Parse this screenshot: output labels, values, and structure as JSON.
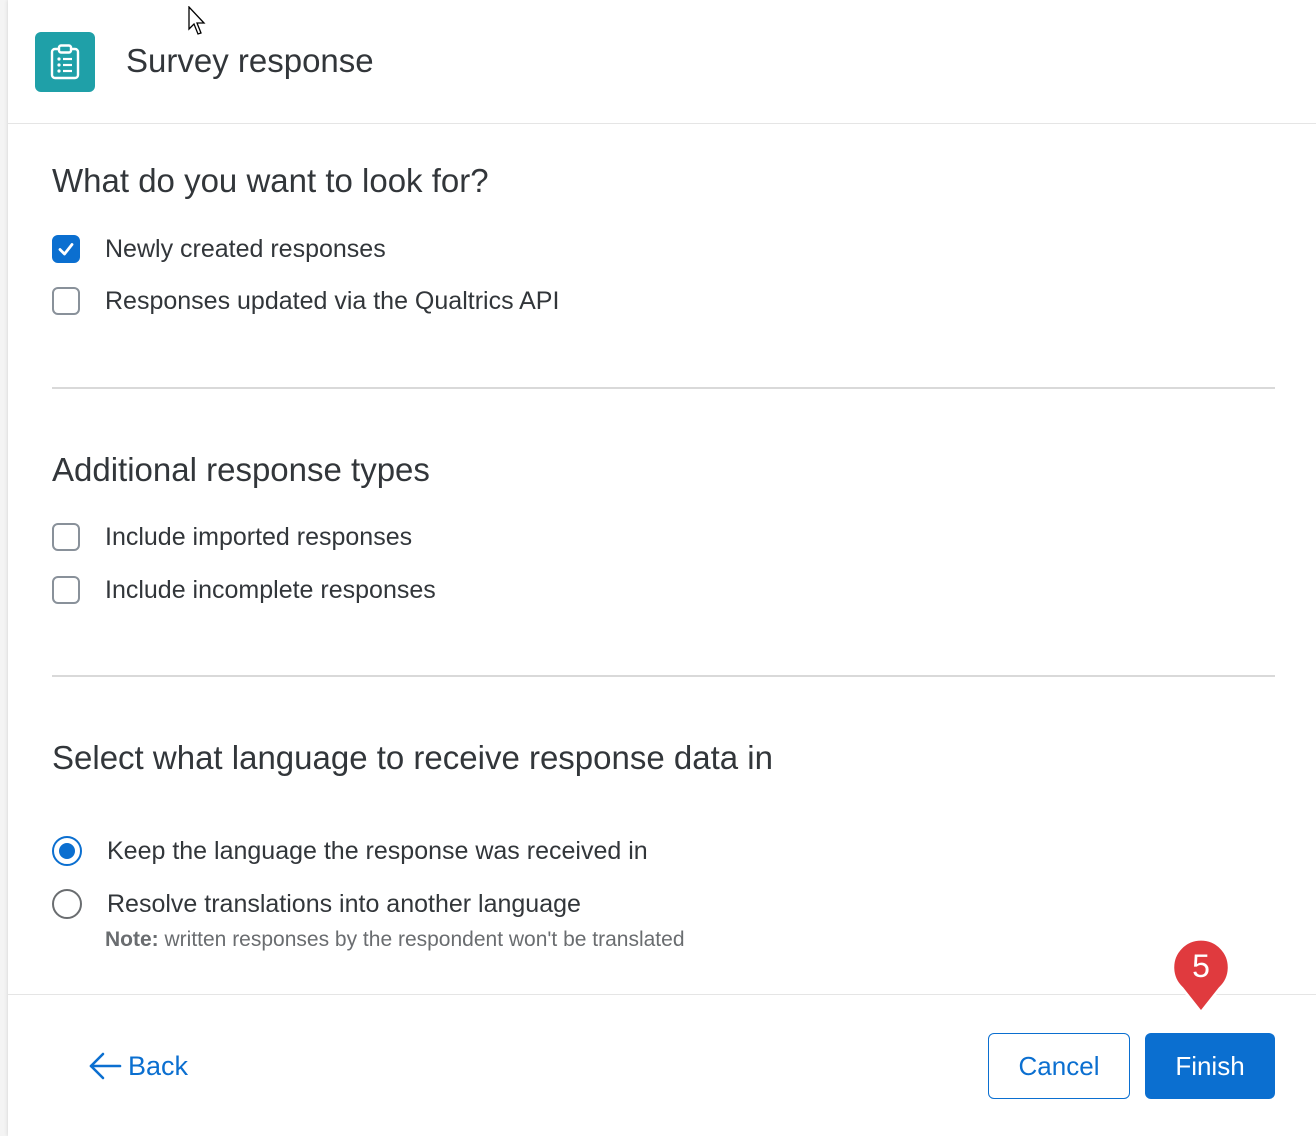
{
  "header": {
    "title": "Survey response",
    "icon": "clipboard-list-icon",
    "icon_bg": "#1fa0a8"
  },
  "section_lookfor": {
    "title": "What do you want to look for?",
    "options": [
      {
        "label": "Newly created responses",
        "checked": true
      },
      {
        "label": "Responses updated via the  Qualtrics API",
        "checked": false
      }
    ]
  },
  "section_additional": {
    "title": "Additional response types",
    "options": [
      {
        "label": "Include imported responses",
        "checked": false
      },
      {
        "label": "Include incomplete responses",
        "checked": false
      }
    ]
  },
  "section_language": {
    "title": "Select what language to receive response data in",
    "options": [
      {
        "label": "Keep the language the response was received in",
        "selected": true
      },
      {
        "label": "Resolve translations into another language",
        "selected": false
      }
    ],
    "note_prefix": "Note:",
    "note_text": " written responses by the respondent won't be translated"
  },
  "footer": {
    "back_label": "Back",
    "cancel_label": "Cancel",
    "finish_label": "Finish"
  },
  "step_marker": {
    "number": "5",
    "color": "#e03a3e"
  },
  "colors": {
    "accent": "#0b6fd0",
    "text": "#32363a"
  }
}
